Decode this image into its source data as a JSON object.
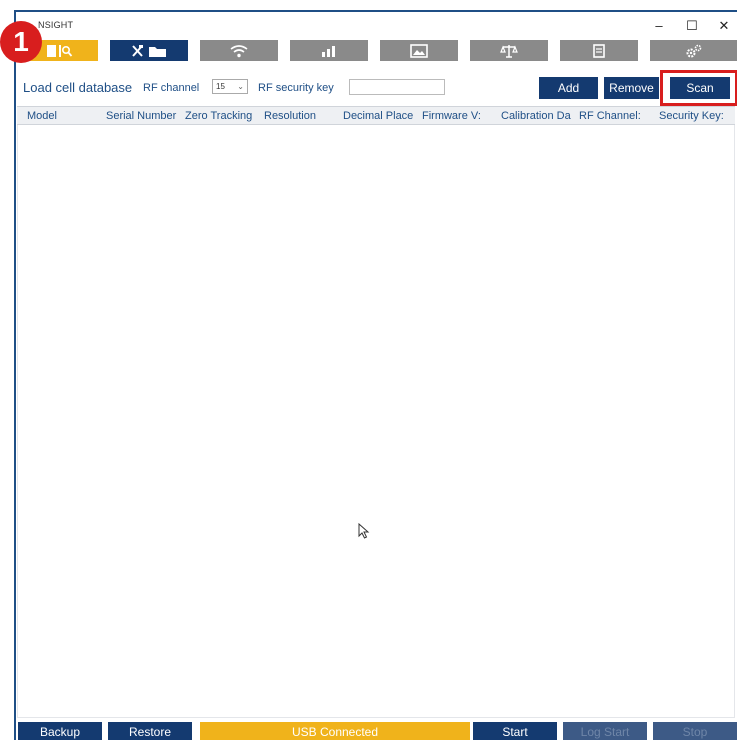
{
  "step_badge": "1",
  "window": {
    "title": "NSIGHT",
    "min_glyph": "–",
    "max_glyph": "☐",
    "close_glyph": "✕"
  },
  "tabs": [
    {
      "icon": "database-search-icon",
      "state": "active"
    },
    {
      "icon": "tools-folder-icon",
      "state": "selected"
    },
    {
      "icon": "wifi-icon",
      "state": "inactive"
    },
    {
      "icon": "chart-icon",
      "state": "inactive"
    },
    {
      "icon": "image-icon",
      "state": "inactive"
    },
    {
      "icon": "scale-icon",
      "state": "inactive"
    },
    {
      "icon": "document-icon",
      "state": "inactive"
    },
    {
      "icon": "settings-gears-icon",
      "state": "inactive"
    }
  ],
  "toolbar": {
    "title": "Load cell database",
    "rf_channel_label": "RF channel",
    "rf_channel_value": "15",
    "rf_key_label": "RF security key",
    "rf_key_value": "",
    "add_label": "Add",
    "remove_label": "Remove",
    "scan_label": "Scan"
  },
  "table": {
    "columns": [
      "Model",
      "Serial Number",
      "Zero Tracking",
      "Resolution",
      "Decimal Place",
      "Firmware V:",
      "Calibration Da",
      "RF Channel:",
      "Security Key:"
    ],
    "rows": []
  },
  "status": {
    "backup_label": "Backup",
    "restore_label": "Restore",
    "connection_label": "USB Connected",
    "start_label": "Start",
    "log_start_label": "Log Start",
    "stop_label": "Stop"
  },
  "colors": {
    "brand_navy": "#143a70",
    "accent_gold": "#f0b31b",
    "highlight_red": "#d81e1e",
    "inactive_gray": "#8a8a8a"
  }
}
